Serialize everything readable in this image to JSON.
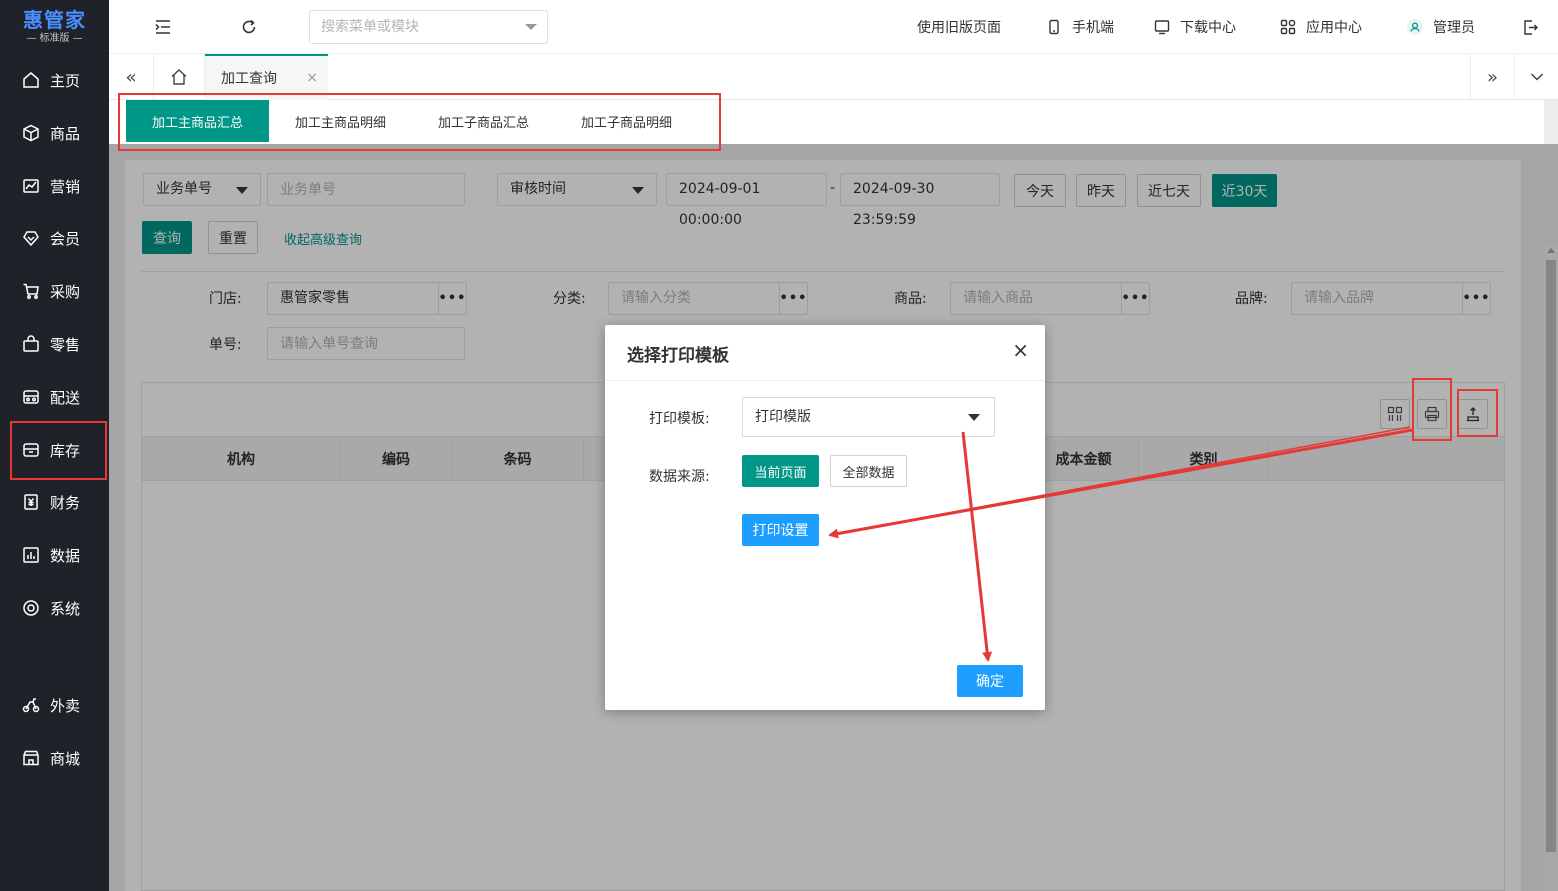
{
  "sidebar": {
    "brand": "惠管家",
    "edition": "— 标准版 —",
    "items": [
      {
        "label": "主页",
        "icon": "home-icon"
      },
      {
        "label": "商品",
        "icon": "cube-icon"
      },
      {
        "label": "营销",
        "icon": "chart-icon"
      },
      {
        "label": "会员",
        "icon": "diamond-icon"
      },
      {
        "label": "采购",
        "icon": "cart-icon"
      },
      {
        "label": "零售",
        "icon": "bag-icon"
      },
      {
        "label": "配送",
        "icon": "truck-icon"
      },
      {
        "label": "库存",
        "icon": "box-icon"
      },
      {
        "label": "财务",
        "icon": "yen-icon"
      },
      {
        "label": "数据",
        "icon": "bar-chart-icon"
      },
      {
        "label": "系统",
        "icon": "target-icon"
      },
      {
        "label": "外卖",
        "icon": "scooter-icon"
      },
      {
        "label": "商城",
        "icon": "store-icon"
      }
    ]
  },
  "header": {
    "search_placeholder": "搜索菜单或模块",
    "links": {
      "old_page": "使用旧版页面",
      "mobile": "手机端",
      "download": "下载中心",
      "apps": "应用中心",
      "user": "管理员"
    }
  },
  "tabs": {
    "active": "加工查询",
    "close": "×"
  },
  "subtabs": [
    "加工主商品汇总",
    "加工主商品明细",
    "加工子商品汇总",
    "加工子商品明细"
  ],
  "filters": {
    "doc_type": "业务单号",
    "doc_placeholder": "业务单号",
    "time_type": "审核时间",
    "date_start": "2024-09-01 00:00:00",
    "date_sep": "-",
    "date_end": "2024-09-30 23:59:59",
    "quick": [
      "今天",
      "昨天",
      "近七天",
      "近30天"
    ],
    "query": "查询",
    "reset": "重置",
    "collapse": "收起高级查询",
    "store_label": "门店:",
    "store_value": "惠管家零售",
    "category_label": "分类:",
    "category_placeholder": "请输入分类",
    "product_label": "商品:",
    "product_placeholder": "请输入商品",
    "brand_label": "品牌:",
    "brand_placeholder": "请输入品牌",
    "order_label": "单号:",
    "order_placeholder": "请输入单号查询",
    "dots": "•••"
  },
  "table": {
    "columns": [
      "机构",
      "编码",
      "条码",
      "成本金额",
      "类别"
    ]
  },
  "modal": {
    "title": "选择打印模板",
    "close": "×",
    "template_label": "打印模板:",
    "template_value": "打印模版",
    "source_label": "数据来源:",
    "current_page": "当前页面",
    "all_data": "全部数据",
    "print_settings": "打印设置",
    "confirm": "确定"
  },
  "colors": {
    "primary": "#009688",
    "blue": "#1e9fff",
    "sidebar": "#1f2229",
    "annotation": "#e53935"
  }
}
